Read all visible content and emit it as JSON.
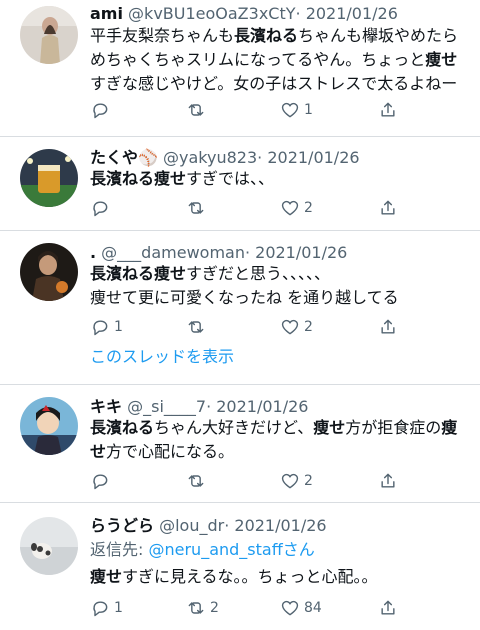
{
  "tweets": [
    {
      "name": "ami",
      "handle": "@kvBU1eoOaZ3xCtY",
      "date": "· 2021/01/26",
      "lines": [
        [
          {
            "t": "平手友梨奈ちゃんも"
          },
          {
            "t": "長濱ねる",
            "b": true
          },
          {
            "t": "ちゃんも欅坂やめたら"
          }
        ],
        [
          {
            "t": "めちゃくちゃスリムになってるやん。ちょっと"
          },
          {
            "t": "痩せ",
            "b": true
          }
        ],
        [
          {
            "t": "すぎな感じやけど。女の子はストレスで太るよねー"
          }
        ]
      ],
      "reply_count": "",
      "retweet_count": "",
      "like_count": "1"
    },
    {
      "name": "たくや⚾",
      "handle": "@yakyu823",
      "date": "· 2021/01/26",
      "lines": [
        [
          {
            "t": "長濱ねる痩せ",
            "b": true
          },
          {
            "t": "すぎでは、、"
          }
        ]
      ],
      "reply_count": "",
      "retweet_count": "",
      "like_count": "2"
    },
    {
      "name": ".",
      "handle": "@___damewoman",
      "date": "· 2021/01/26",
      "lines": [
        [
          {
            "t": "長濱ねる痩せ",
            "b": true
          },
          {
            "t": "すぎだと思う、、、、、"
          }
        ],
        [
          {
            "t": "痩せて更に可愛くなったね を通り越してる"
          }
        ]
      ],
      "reply_count": "1",
      "retweet_count": "",
      "like_count": "2",
      "thread_link": "このスレッドを表示"
    },
    {
      "name": "キキ",
      "handle": "@_si____7",
      "date": "· 2021/01/26",
      "lines": [
        [
          {
            "t": "長濱ねる",
            "b": true
          },
          {
            "t": "ちゃん大好きだけど、"
          },
          {
            "t": "痩せ",
            "b": true
          },
          {
            "t": "方が拒食症の"
          },
          {
            "t": "痩",
            "b": true
          }
        ],
        [
          {
            "t": "せ",
            "b": true
          },
          {
            "t": "方で心配になる。"
          }
        ]
      ],
      "reply_count": "",
      "retweet_count": "",
      "like_count": "2"
    },
    {
      "name": "らうどら",
      "handle": "@lou_dr",
      "date": "· 2021/01/26",
      "reply_to_label": "返信先: ",
      "reply_to_handle": "@neru_and_staff",
      "reply_to_suffix": "さん",
      "lines": [
        [
          {
            "t": "痩せ",
            "b": true
          },
          {
            "t": "すぎに見えるな。。ちょっと心配。。"
          }
        ]
      ],
      "reply_count": "1",
      "retweet_count": "2",
      "like_count": "84"
    }
  ],
  "icons": {
    "reply": "reply-icon",
    "retweet": "retweet-icon",
    "like": "heart-icon",
    "share": "share-icon"
  },
  "colors": {
    "text": "#0f1419",
    "meta": "#536471",
    "link": "#1d9bf0",
    "divider": "#d9dde1"
  }
}
